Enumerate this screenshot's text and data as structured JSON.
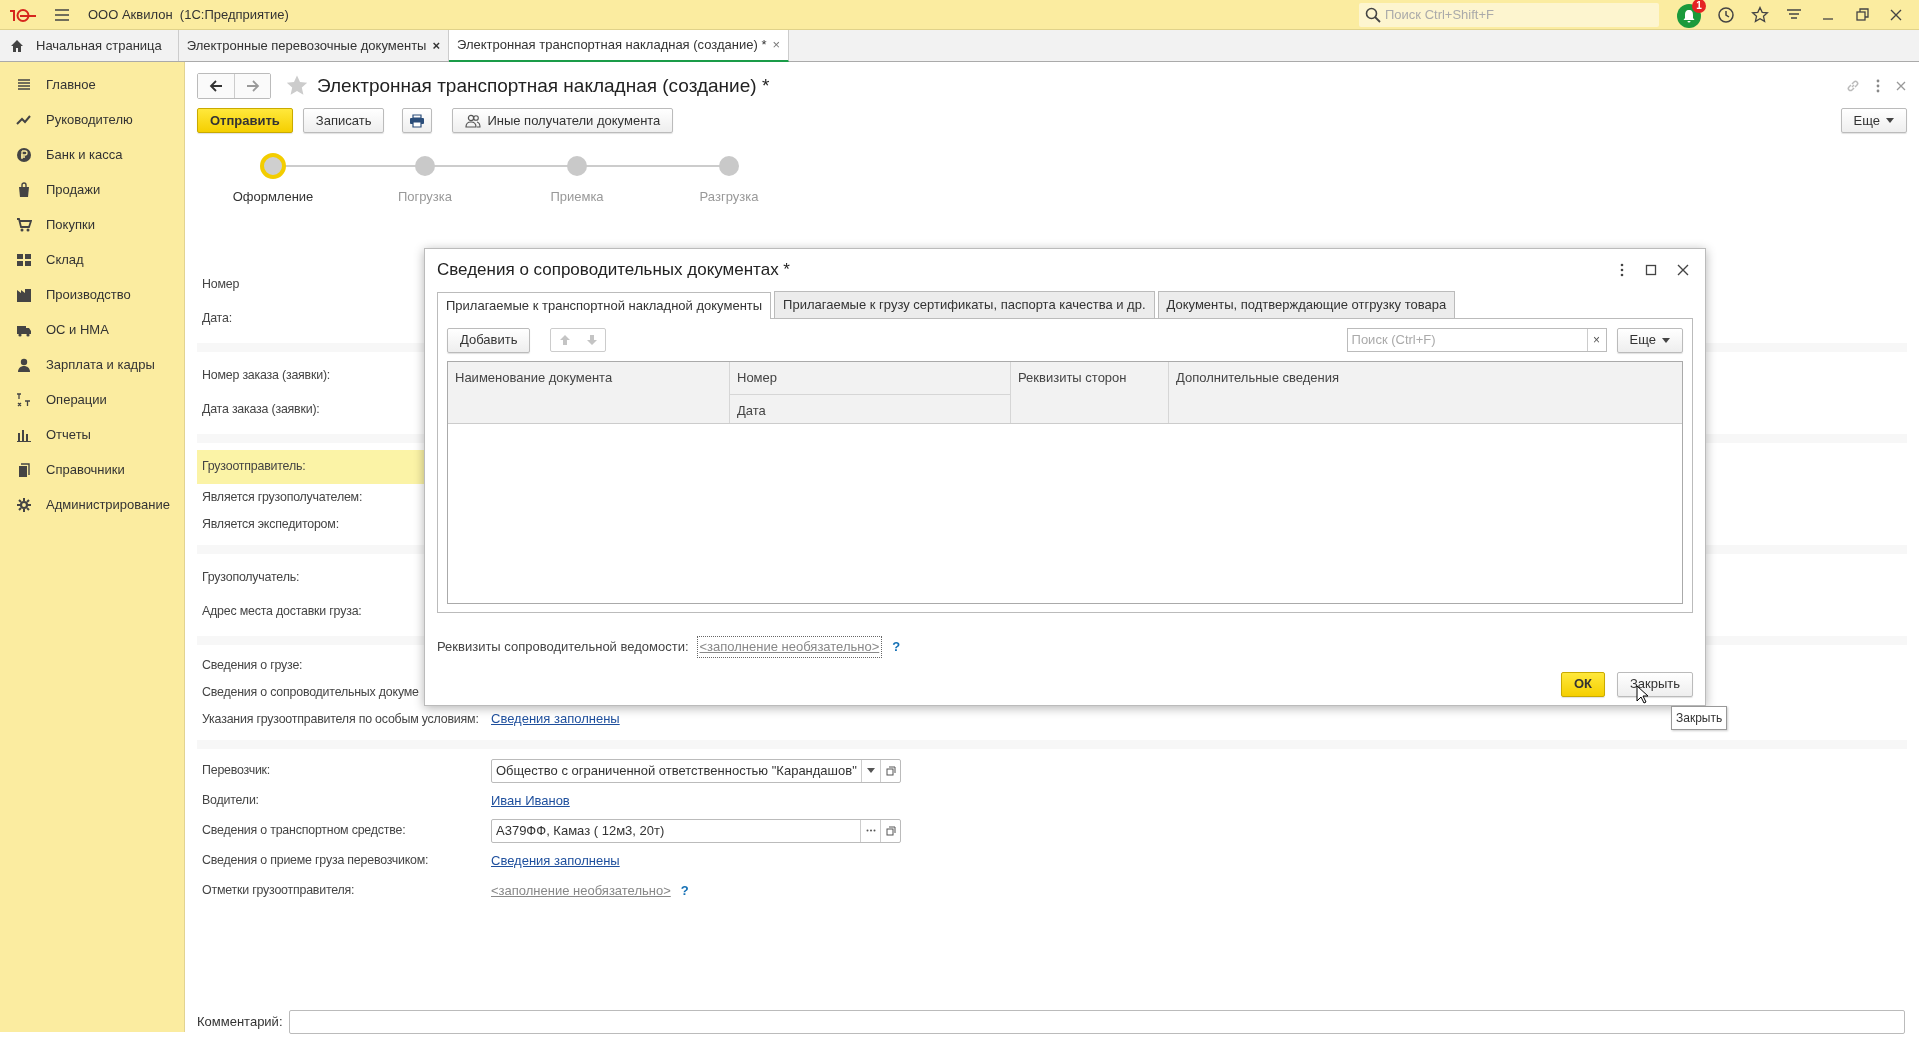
{
  "window": {
    "title": "ООО Аквилон  (1С:Предприятие)",
    "search_placeholder": "Поиск Ctrl+Shift+F",
    "notification_count": "1"
  },
  "tabs": [
    {
      "label": "Начальная страница",
      "kind": "home",
      "selected": false
    },
    {
      "label": "Электронные перевозочные документы",
      "kind": "closable",
      "selected": false,
      "close": "×"
    },
    {
      "label": "Электронная транспортная накладная (создание) *",
      "kind": "closable",
      "selected": true,
      "close": "×"
    }
  ],
  "sidebar": {
    "items": [
      {
        "label": "Главное"
      },
      {
        "label": "Руководителю"
      },
      {
        "label": "Банк и касса"
      },
      {
        "label": "Продажи"
      },
      {
        "label": "Покупки"
      },
      {
        "label": "Склад"
      },
      {
        "label": "Производство"
      },
      {
        "label": "ОС и НМА"
      },
      {
        "label": "Зарплата и кадры"
      },
      {
        "label": "Операции"
      },
      {
        "label": "Отчеты"
      },
      {
        "label": "Справочники"
      },
      {
        "label": "Администрирование"
      }
    ]
  },
  "document": {
    "title": "Электронная транспортная накладная (создание) *",
    "buttons": [
      {
        "kind": "primary",
        "label": "Отправить"
      },
      {
        "kind": "default",
        "label": "Записать"
      },
      {
        "kind": "print"
      },
      {
        "kind": "recipients",
        "label": "Иные получатели документа"
      }
    ],
    "more_button": "Еще",
    "steps": [
      {
        "label": "Оформление",
        "selected": true
      },
      {
        "label": "Погрузка",
        "selected": false
      },
      {
        "label": "Приемка",
        "selected": false
      },
      {
        "label": "Разгрузка",
        "selected": false
      }
    ],
    "sections": [
      [
        {
          "label": "Номер",
          "highlighted": false
        },
        {
          "label": "Дата:",
          "highlighted": false
        }
      ],
      [
        {
          "label": "Номер заказа (заявки):",
          "highlighted": false
        },
        {
          "label": "Дата заказа (заявки):",
          "highlighted": false
        }
      ],
      [
        {
          "label": "Грузоотправитель:",
          "highlighted": true
        },
        {
          "label": "Является грузополучателем:",
          "highlighted": false
        },
        {
          "label": "Является экспедитором:",
          "highlighted": false
        }
      ],
      [
        {
          "label": "Грузополучатель:",
          "highlighted": false
        },
        {
          "label": "Адрес места доставки груза:",
          "highlighted": false
        }
      ],
      [
        {
          "label": "Сведения о грузе:",
          "highlighted": false
        },
        {
          "label": "Сведения о сопроводительных докуме",
          "highlighted": false
        },
        {
          "label": "Указания грузоотправителя по особым условиям:",
          "highlighted": false,
          "kind": "link",
          "value": "Сведения заполнены"
        }
      ],
      [
        {
          "label": "Перевозчик:",
          "highlighted": false,
          "kind": "select",
          "value": "Общество с ограниченной ответственностью \"Карандашов\""
        },
        {
          "label": "Водители:",
          "highlighted": false,
          "kind": "link",
          "value": "Иван Иванов"
        },
        {
          "label": "Сведения о транспортном средстве:",
          "highlighted": false,
          "kind": "choice",
          "value": "А379ФФ, Камаз ( 12м3, 20т)"
        },
        {
          "label": "Сведения о приеме груза перевозчиком:",
          "highlighted": false,
          "kind": "link",
          "value": "Сведения заполнены"
        },
        {
          "label": "Отметки грузоотправителя:",
          "highlighted": false,
          "kind": "optional",
          "value": "<заполнение необязательно>",
          "help": "?"
        }
      ]
    ],
    "comment_label": "Комментарий:"
  },
  "dialog": {
    "title": "Сведения о сопроводительных документах *",
    "tabs": [
      {
        "label": "Прилагаемые к транспортной накладной документы",
        "selected": true
      },
      {
        "label": "Прилагаемые к грузу сертификаты, паспорта качества и др.",
        "selected": false
      },
      {
        "label": "Документы, подтверждающие отгрузку товара",
        "selected": false
      }
    ],
    "add_button": "Добавить",
    "search_placeholder": "Поиск (Ctrl+F)",
    "clear_button": "×",
    "more_button": "Еще",
    "table": {
      "columns": [
        {
          "label": "Наименование документа"
        },
        {
          "label": "Номер",
          "sub_label": "Дата"
        },
        {
          "label": "Реквизиты сторон"
        },
        {
          "label": "Дополнительные сведения"
        }
      ]
    },
    "statement_label": "Реквизиты сопроводительной ведомости:",
    "statement_value": "<заполнение необязательно>",
    "help": "?",
    "ok_button": "ОК",
    "close_button": "Закрыть",
    "tooltip": "Закрыть"
  }
}
